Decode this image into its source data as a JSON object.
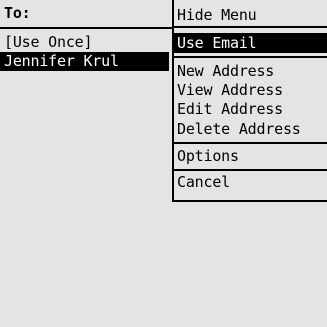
{
  "address_field": {
    "label": "To:"
  },
  "contacts": [
    {
      "name": "[Use Once]",
      "selected": false
    },
    {
      "name": "Jennifer Krul",
      "selected": true
    }
  ],
  "menu": {
    "items": [
      {
        "label": "Hide Menu",
        "highlighted": false
      },
      {
        "label": "Use Email",
        "highlighted": true
      },
      {
        "label": "New Address",
        "highlighted": false
      },
      {
        "label": "View Address",
        "highlighted": false
      },
      {
        "label": "Edit Address",
        "highlighted": false
      },
      {
        "label": "Delete Address",
        "highlighted": false
      },
      {
        "label": "Options",
        "highlighted": false
      },
      {
        "label": "Cancel",
        "highlighted": false
      }
    ]
  },
  "colors": {
    "background": "#e4e4e4",
    "text": "#000000",
    "highlight_bg": "#000000",
    "highlight_text": "#ffffff"
  }
}
